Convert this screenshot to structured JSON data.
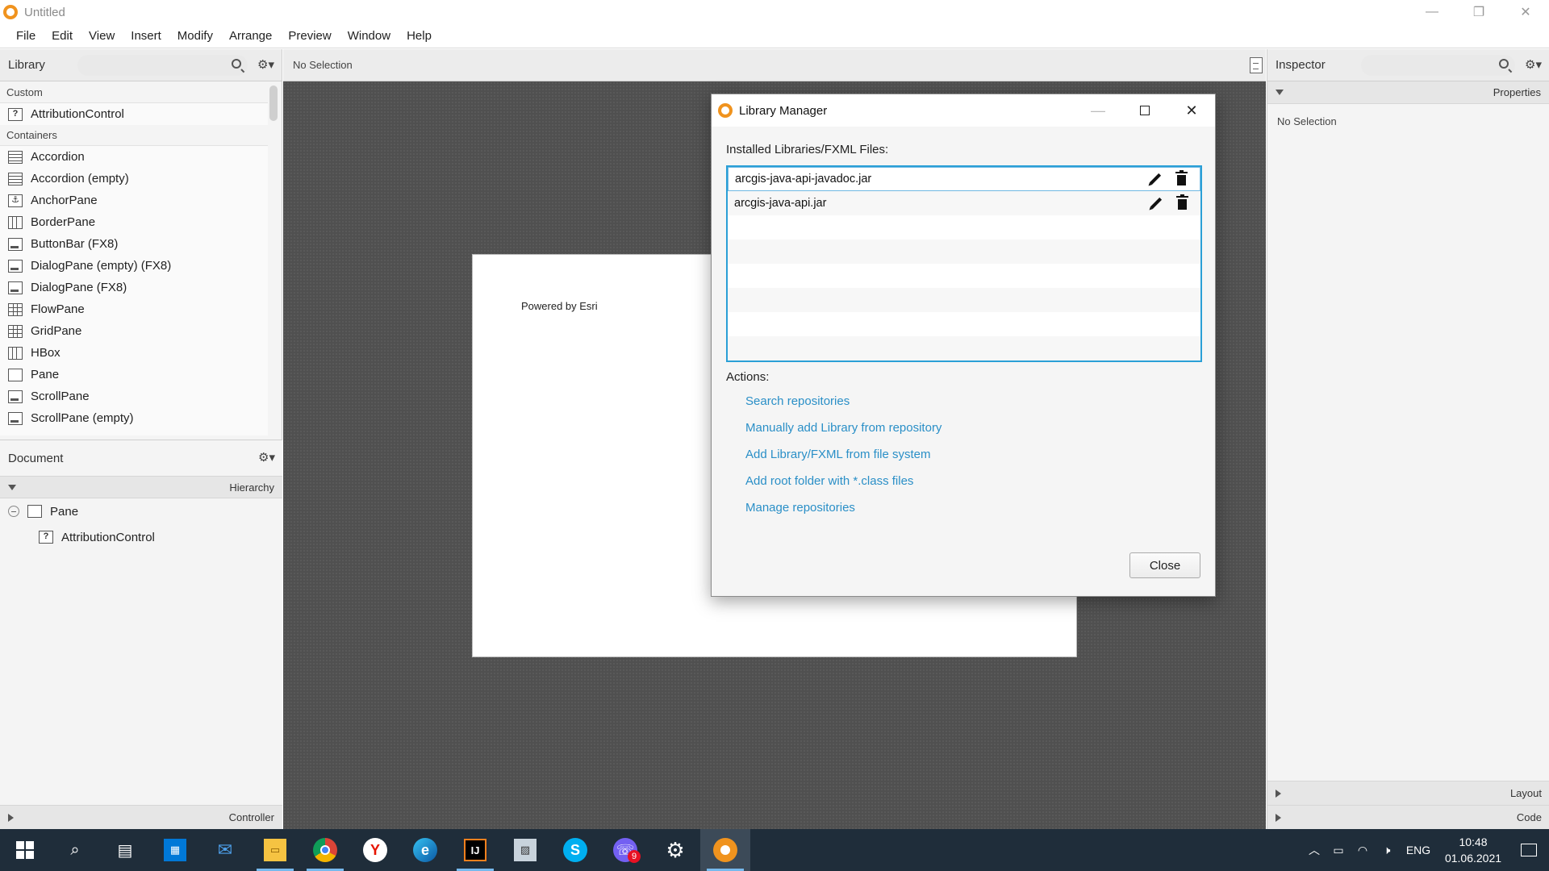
{
  "window": {
    "title": "Untitled",
    "controls": {
      "minimize": "—",
      "restore": "❐",
      "close": "✕"
    }
  },
  "menu": [
    "File",
    "Edit",
    "View",
    "Insert",
    "Modify",
    "Arrange",
    "Preview",
    "Window",
    "Help"
  ],
  "library": {
    "title": "Library",
    "search_placeholder": "",
    "sections": [
      {
        "label": "Custom",
        "items": [
          {
            "label": "AttributionControl",
            "icon": "unknown-control-icon"
          }
        ]
      },
      {
        "label": "Containers",
        "items": [
          {
            "label": "Accordion",
            "icon": "accordion-icon"
          },
          {
            "label": "Accordion  (empty)",
            "icon": "accordion-icon"
          },
          {
            "label": "AnchorPane",
            "icon": "anchorpane-icon"
          },
          {
            "label": "BorderPane",
            "icon": "borderpane-icon"
          },
          {
            "label": "ButtonBar  (FX8)",
            "icon": "buttonbar-icon"
          },
          {
            "label": "DialogPane (empty)  (FX8)",
            "icon": "dialogpane-icon"
          },
          {
            "label": "DialogPane  (FX8)",
            "icon": "dialogpane-icon"
          },
          {
            "label": "FlowPane",
            "icon": "flowpane-icon"
          },
          {
            "label": "GridPane",
            "icon": "gridpane-icon"
          },
          {
            "label": "HBox",
            "icon": "hbox-icon"
          },
          {
            "label": "Pane",
            "icon": "pane-icon"
          },
          {
            "label": "ScrollPane",
            "icon": "scrollpane-icon"
          },
          {
            "label": "ScrollPane  (empty)",
            "icon": "scrollpane-icon"
          }
        ]
      }
    ]
  },
  "document": {
    "title": "Document",
    "hierarchy_label": "Hierarchy",
    "tree": [
      {
        "label": "Pane",
        "level": 0
      },
      {
        "label": "AttributionControl",
        "level": 1
      }
    ],
    "controller_label": "Controller"
  },
  "canvas": {
    "selection_status": "No Selection",
    "pane_text": "Powered by Esri"
  },
  "inspector": {
    "title": "Inspector",
    "search_placeholder": "",
    "properties_label": "Properties",
    "no_selection": "No Selection",
    "layout_label": "Layout",
    "code_label": "Code"
  },
  "dialog": {
    "title": "Library Manager",
    "installed_label": "Installed Libraries/FXML Files:",
    "files": [
      "arcgis-java-api-javadoc.jar",
      "arcgis-java-api.jar"
    ],
    "actions_label": "Actions:",
    "actions": [
      "Search repositories",
      "Manually add Library from repository",
      "Add Library/FXML from file system",
      "Add root folder with *.class files",
      "Manage repositories"
    ],
    "close_label": "Close"
  },
  "taskbar": {
    "apps": [
      "start",
      "search",
      "task-view",
      "store",
      "mail",
      "file-explorer",
      "chrome",
      "yandex",
      "edge",
      "intellij",
      "paint",
      "skype",
      "viber",
      "settings",
      "scene-builder"
    ],
    "viber_badge": "9",
    "language": "ENG",
    "time": "10:48",
    "date": "01.06.2021"
  },
  "colors": {
    "accent_blue": "#2a9fd6",
    "link": "#2a8fc7",
    "app_orange": "#f0931e",
    "taskbar": "#1f2d3a"
  }
}
